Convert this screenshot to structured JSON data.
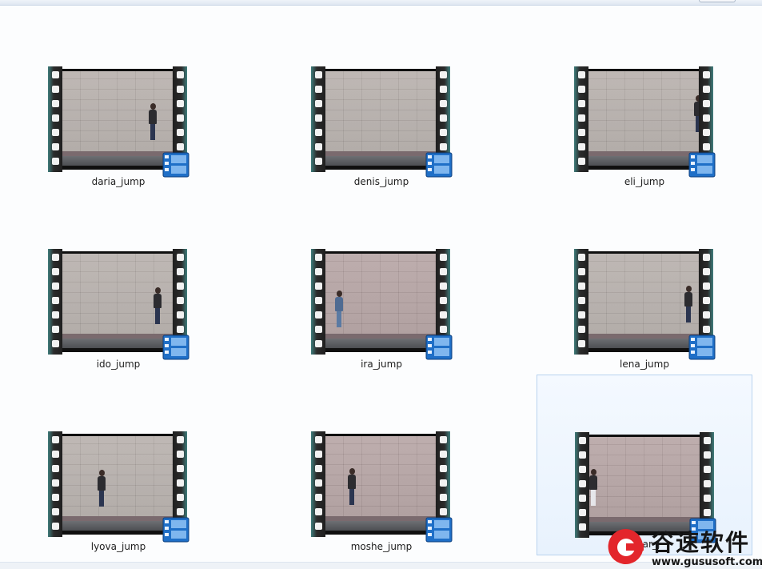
{
  "files": [
    {
      "name": "daria_jump"
    },
    {
      "name": "denis_jump"
    },
    {
      "name": "eli_jump"
    },
    {
      "name": "ido_jump"
    },
    {
      "name": "ira_jump"
    },
    {
      "name": "lena_jump"
    },
    {
      "name": "lyova_jump"
    },
    {
      "name": "moshe_jump"
    },
    {
      "name": "shahar_jump",
      "visible_label": "ahar_j",
      "selected": true
    }
  ],
  "watermark": {
    "title": "谷速软件",
    "url": "www.gususoft.com"
  },
  "icons": {
    "thumbnail_overlay": "video-file-icon",
    "watermark_logo": "gusu-logo-icon"
  },
  "colors": {
    "selection_bg": "#e8f2fd",
    "selection_border": "#b9d3ef",
    "badge_blue": "#1f6fc7",
    "logo_red": "#e3262b"
  }
}
